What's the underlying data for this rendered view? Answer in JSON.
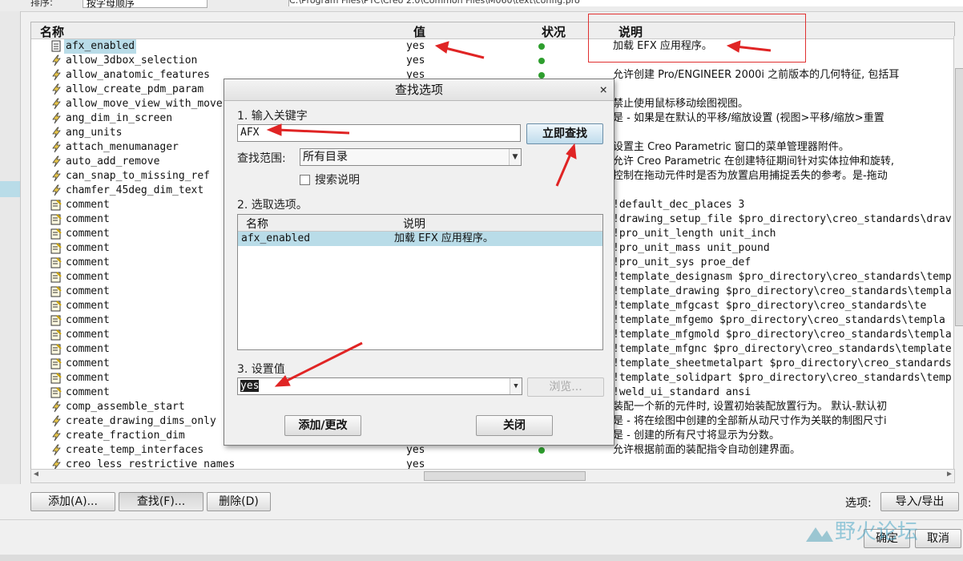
{
  "topbar": {
    "sort_label": "排序:",
    "sort_value": "按字母顺序",
    "path_text": "C:\\Program Files\\PTC\\Creo 2.0\\Common Files\\M060\\text\\config.pro"
  },
  "table": {
    "headers": {
      "name": "名称",
      "value": "值",
      "status": "状况",
      "desc": "说明"
    },
    "rows": [
      {
        "icon": "config-file-icon",
        "name": "afx_enabled",
        "value": "yes",
        "status": true,
        "desc": "加载 EFX 应用程序。",
        "highlight": true
      },
      {
        "icon": "lightning-icon",
        "name": "allow_3dbox_selection",
        "value": "yes",
        "status": true,
        "desc": ""
      },
      {
        "icon": "lightning-icon",
        "name": "allow_anatomic_features",
        "value": "yes",
        "status": true,
        "desc": "允许创建 Pro/ENGINEER 2000i 之前版本的几何特征, 包括耳"
      },
      {
        "icon": "lightning-icon",
        "name": "allow_create_pdm_param",
        "value": "",
        "status": false,
        "desc": ""
      },
      {
        "icon": "lightning-icon",
        "name": "allow_move_view_with_move",
        "value": "",
        "status": false,
        "desc": "禁止使用鼠标移动绘图视图。"
      },
      {
        "icon": "lightning-icon",
        "name": "ang_dim_in_screen",
        "value": "",
        "status": false,
        "desc": "是 - 如果是在默认的平移/缩放设置 (视图>平移/缩放>重置"
      },
      {
        "icon": "lightning-icon",
        "name": "ang_units",
        "value": "",
        "status": false,
        "desc": ""
      },
      {
        "icon": "lightning-icon",
        "name": "attach_menumanager",
        "value": "",
        "status": false,
        "desc": "设置主 Creo Parametric 窗口的菜单管理器附件。"
      },
      {
        "icon": "lightning-icon",
        "name": "auto_add_remove",
        "value": "",
        "status": false,
        "desc": "允许 Creo Parametric 在创建特征期间针对实体拉伸和旋转,"
      },
      {
        "icon": "lightning-icon",
        "name": "can_snap_to_missing_ref",
        "value": "",
        "status": false,
        "desc": "控制在拖动元件时是否为放置启用捕捉丢失的参考。是-拖动"
      },
      {
        "icon": "lightning-icon",
        "name": "chamfer_45deg_dim_text",
        "value": "",
        "status": false,
        "desc": ""
      },
      {
        "icon": "note-icon",
        "name": "comment",
        "value": "",
        "status": false,
        "desc": "!default_dec_places 3"
      },
      {
        "icon": "note-icon",
        "name": "comment",
        "value": "",
        "status": false,
        "desc": "!drawing_setup_file $pro_directory\\creo_standards\\drav"
      },
      {
        "icon": "note-icon",
        "name": "comment",
        "value": "",
        "status": false,
        "desc": "!pro_unit_length unit_inch"
      },
      {
        "icon": "note-icon",
        "name": "comment",
        "value": "",
        "status": false,
        "desc": "!pro_unit_mass unit_pound"
      },
      {
        "icon": "note-icon",
        "name": "comment",
        "value": "",
        "status": false,
        "desc": "!pro_unit_sys proe_def"
      },
      {
        "icon": "note-icon",
        "name": "comment",
        "value": "",
        "status": false,
        "desc": "!template_designasm $pro_directory\\creo_standards\\temp"
      },
      {
        "icon": "note-icon",
        "name": "comment",
        "value": "",
        "status": false,
        "desc": "!template_drawing $pro_directory\\creo_standards\\templa"
      },
      {
        "icon": "note-icon",
        "name": "comment",
        "value": "",
        "status": false,
        "desc": "!template_mfgcast $pro_directory\\creo_standards\\te"
      },
      {
        "icon": "note-icon",
        "name": "comment",
        "value": "",
        "status": false,
        "desc": "!template_mfgemo $pro_directory\\creo_standards\\templa"
      },
      {
        "icon": "note-icon",
        "name": "comment",
        "value": "",
        "status": false,
        "desc": "!template_mfgmold $pro_directory\\creo_standards\\templa"
      },
      {
        "icon": "note-icon",
        "name": "comment",
        "value": "",
        "status": false,
        "desc": "!template_mfgnc $pro_directory\\creo_standards\\template"
      },
      {
        "icon": "note-icon",
        "name": "comment",
        "value": "",
        "status": false,
        "desc": "!template_sheetmetalpart $pro_directory\\creo_standards"
      },
      {
        "icon": "note-icon",
        "name": "comment",
        "value": "",
        "status": false,
        "desc": "!template_solidpart $pro_directory\\creo_standards\\temp"
      },
      {
        "icon": "note-icon",
        "name": "comment",
        "value": "",
        "status": false,
        "desc": "!weld_ui_standard ansi"
      },
      {
        "icon": "lightning-icon",
        "name": "comp_assemble_start",
        "value": "",
        "status": false,
        "desc": "装配一个新的元件时, 设置初始装配放置行为。 默认-默认初"
      },
      {
        "icon": "lightning-icon",
        "name": "create_drawing_dims_only",
        "value": "",
        "status": false,
        "desc": "是 - 将在绘图中创建的全部新从动尺寸作为关联的制图尺寸i"
      },
      {
        "icon": "lightning-icon",
        "name": "create_fraction_dim",
        "value": "",
        "status": false,
        "desc": "是 - 创建的所有尺寸将显示为分数。"
      },
      {
        "icon": "lightning-icon",
        "name": "create_temp_interfaces",
        "value": "yes",
        "status": true,
        "desc": "允许根据前面的装配指令自动创建界面。"
      },
      {
        "icon": "lightning-icon",
        "name": "creo_less_restrictive_names",
        "value": "yes",
        "status": false,
        "desc": ""
      }
    ]
  },
  "dialog": {
    "title": "查找选项",
    "step1_label": "1.  输入关键字",
    "keyword_value": "AFX",
    "search_now_button": "立即查找",
    "scope_label": "查找范围:",
    "scope_value": "所有目录",
    "search_desc_label": "搜索说明",
    "step2_label": "2.  选取选项。",
    "result_headers": {
      "name": "名称",
      "desc": "说明"
    },
    "result_row": {
      "name": "afx_enabled",
      "desc": "加载 EFX 应用程序。"
    },
    "step3_label": "3.  设置值",
    "value_field": "yes",
    "browse_button": "浏览...",
    "add_change_button": "添加/更改",
    "close_button": "关闭",
    "close_x": "×"
  },
  "bottombar": {
    "add_button": "添加(A)...",
    "find_button": "查找(F)...",
    "delete_button": "删除(D)",
    "options_label": "选项:",
    "import_export_button": "导入/导出",
    "confirm_button": "确定",
    "cancel_button": "取消"
  },
  "watermark": {
    "text": "野火论坛"
  },
  "colors": {
    "selection": "#b9dce8",
    "arrow": "#e02424",
    "status_dot": "#2e9e2e"
  }
}
